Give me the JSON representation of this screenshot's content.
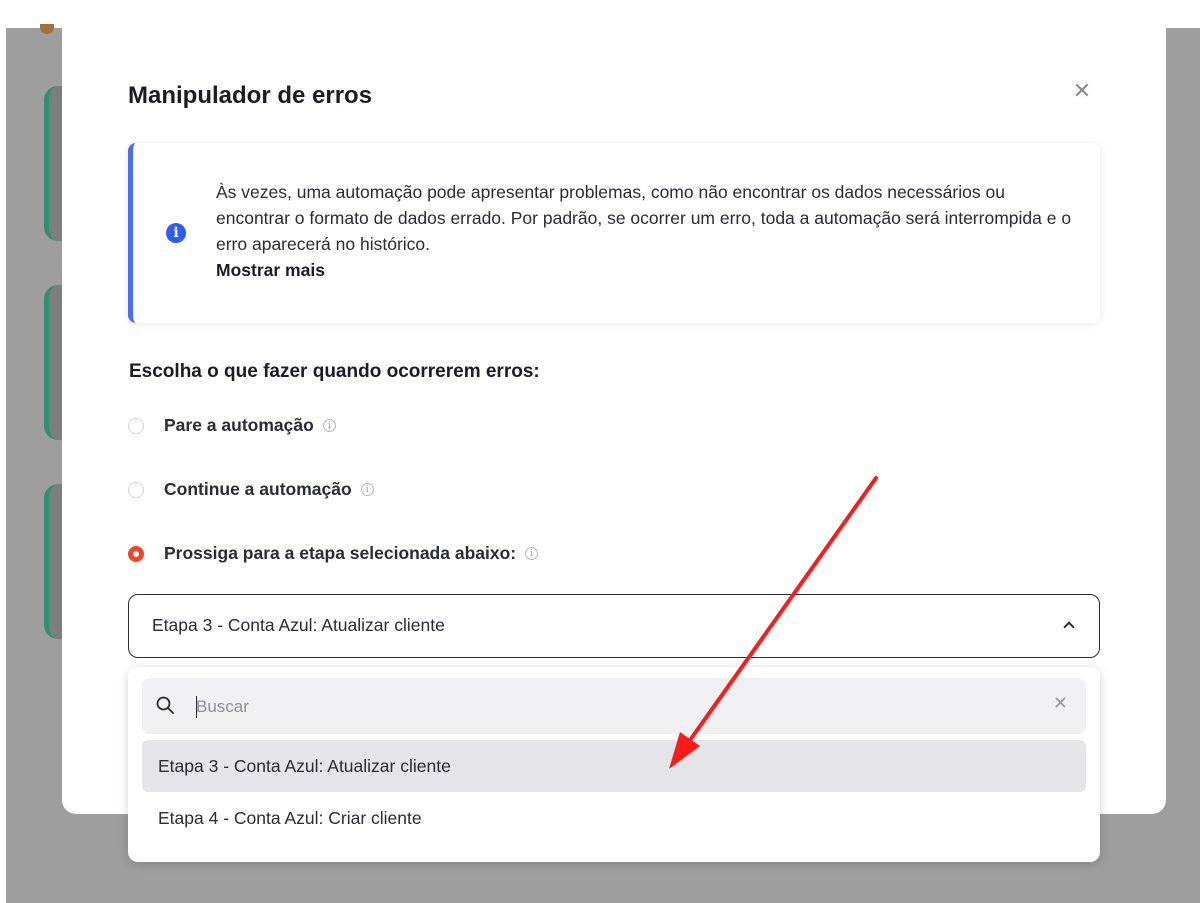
{
  "modal": {
    "title": "Manipulador de erros",
    "close_icon": "close-icon"
  },
  "info": {
    "icon": "info-icon",
    "text": "Às vezes, uma automação pode apresentar problemas, como não encontrar os dados necessários ou encontrar o formato de dados errado. Por padrão, se ocorrer um erro, toda a automação será interrompida e o erro aparecerá no histórico.",
    "show_more": "Mostrar mais",
    "accent_color": "#4a6cf7"
  },
  "options_section": {
    "heading": "Escolha o que fazer quando ocorrerem erros:",
    "radios": [
      {
        "label": "Pare a automação",
        "selected": false
      },
      {
        "label": "Continue a automação",
        "selected": false
      },
      {
        "label": "Prossiga para a etapa selecionada abaixo:",
        "selected": true
      }
    ],
    "selected_color": "#f1442a"
  },
  "select": {
    "value": "Etapa 3 - Conta Azul: Atualizar cliente",
    "icon": "chevron-up-icon"
  },
  "dropdown": {
    "search_placeholder": "Buscar",
    "search_icon": "search-icon",
    "clear_icon": "close-icon",
    "options": [
      {
        "label": "Etapa 3 - Conta Azul: Atualizar cliente",
        "highlighted": true
      },
      {
        "label": "Etapa 4 - Conta Azul: Criar cliente",
        "highlighted": false
      }
    ]
  },
  "annotation": {
    "type": "red-arrow",
    "color": "#ff1a1a"
  }
}
